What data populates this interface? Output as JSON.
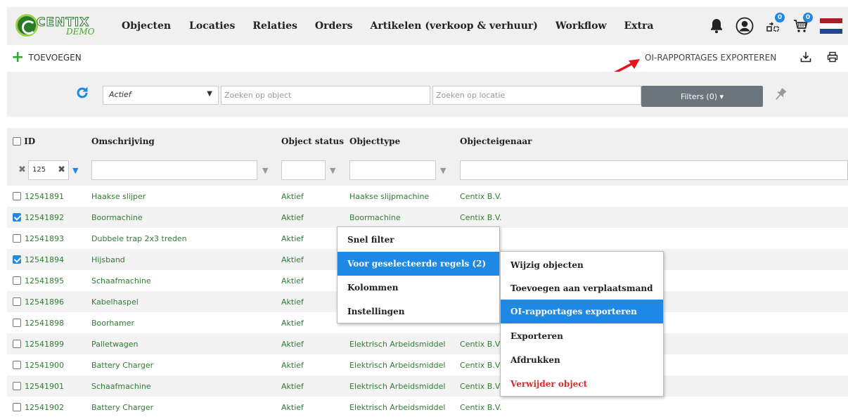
{
  "app": {
    "logo_text": "CENTIX",
    "logo_sub": "DEMO"
  },
  "nav": [
    "Objecten",
    "Locaties",
    "Relaties",
    "Orders",
    "Artikelen (verkoop & verhuur)",
    "Workflow",
    "Extra"
  ],
  "top_icons": {
    "bell": "bell-icon",
    "user": "user-icon",
    "move_badge": "0",
    "cart_badge": "0"
  },
  "flag_colors": [
    "#ae1c28",
    "#ffffff",
    "#21468b"
  ],
  "actions": {
    "add": "TOEVOEGEN",
    "export": "OI-RAPPORTAGES EXPORTEREN"
  },
  "filters": {
    "status_selected": "Actief",
    "search_object_placeholder": "Zoeken op object",
    "search_location_placeholder": "Zoeken op locatie",
    "filters_button": "Filters (0) ▾"
  },
  "table": {
    "columns": [
      "ID",
      "Omschrijving",
      "Object status",
      "Objecttype",
      "Objecteigenaar"
    ],
    "id_filter_value": "125",
    "rows": [
      {
        "checked": false,
        "id": "12541891",
        "desc": "Haakse slijper",
        "status": "Aktief",
        "type": "Haakse slijpmachine",
        "owner": "Centix B.V."
      },
      {
        "checked": true,
        "id": "12541892",
        "desc": "Boormachine",
        "status": "Aktief",
        "type": "Boormachine",
        "owner": "Centix B.V."
      },
      {
        "checked": false,
        "id": "12541893",
        "desc": "Dubbele trap 2x3 treden",
        "status": "Aktief",
        "type": "",
        "owner": ""
      },
      {
        "checked": true,
        "id": "12541894",
        "desc": "Hijsband",
        "status": "Aktief",
        "type": "",
        "owner": ""
      },
      {
        "checked": false,
        "id": "12541895",
        "desc": "Schaafmachine",
        "status": "Aktief",
        "type": "",
        "owner": ""
      },
      {
        "checked": false,
        "id": "12541896",
        "desc": "Kabelhaspel",
        "status": "Aktief",
        "type": "",
        "owner": ""
      },
      {
        "checked": false,
        "id": "12541898",
        "desc": "Boorhamer",
        "status": "Aktief",
        "type": "",
        "owner": ""
      },
      {
        "checked": false,
        "id": "12541899",
        "desc": "Palletwagen",
        "status": "Aktief",
        "type": "Elektrisch Arbeidsmiddel",
        "owner": "Centix B.V."
      },
      {
        "checked": false,
        "id": "12541900",
        "desc": "Battery Charger",
        "status": "Aktief",
        "type": "Elektrisch Arbeidsmiddel",
        "owner": "Centix B.V."
      },
      {
        "checked": false,
        "id": "12541901",
        "desc": "Schaafmachine",
        "status": "Aktief",
        "type": "Elektrisch Arbeidsmiddel",
        "owner": "Centix B.V."
      },
      {
        "checked": false,
        "id": "12541902",
        "desc": "Battery Charger",
        "status": "Aktief",
        "type": "Elektrisch Arbeidsmiddel",
        "owner": "Centix B.V."
      }
    ]
  },
  "context_menu": [
    "Snel filter",
    "Voor geselecteerde regels (2)",
    "Kolommen",
    "Instellingen"
  ],
  "submenu": [
    "Wijzig objecten",
    "Toevoegen aan verplaatsmand",
    "OI-rapportages exporteren",
    "Exporteren",
    "Afdrukken",
    "Verwijder object"
  ]
}
